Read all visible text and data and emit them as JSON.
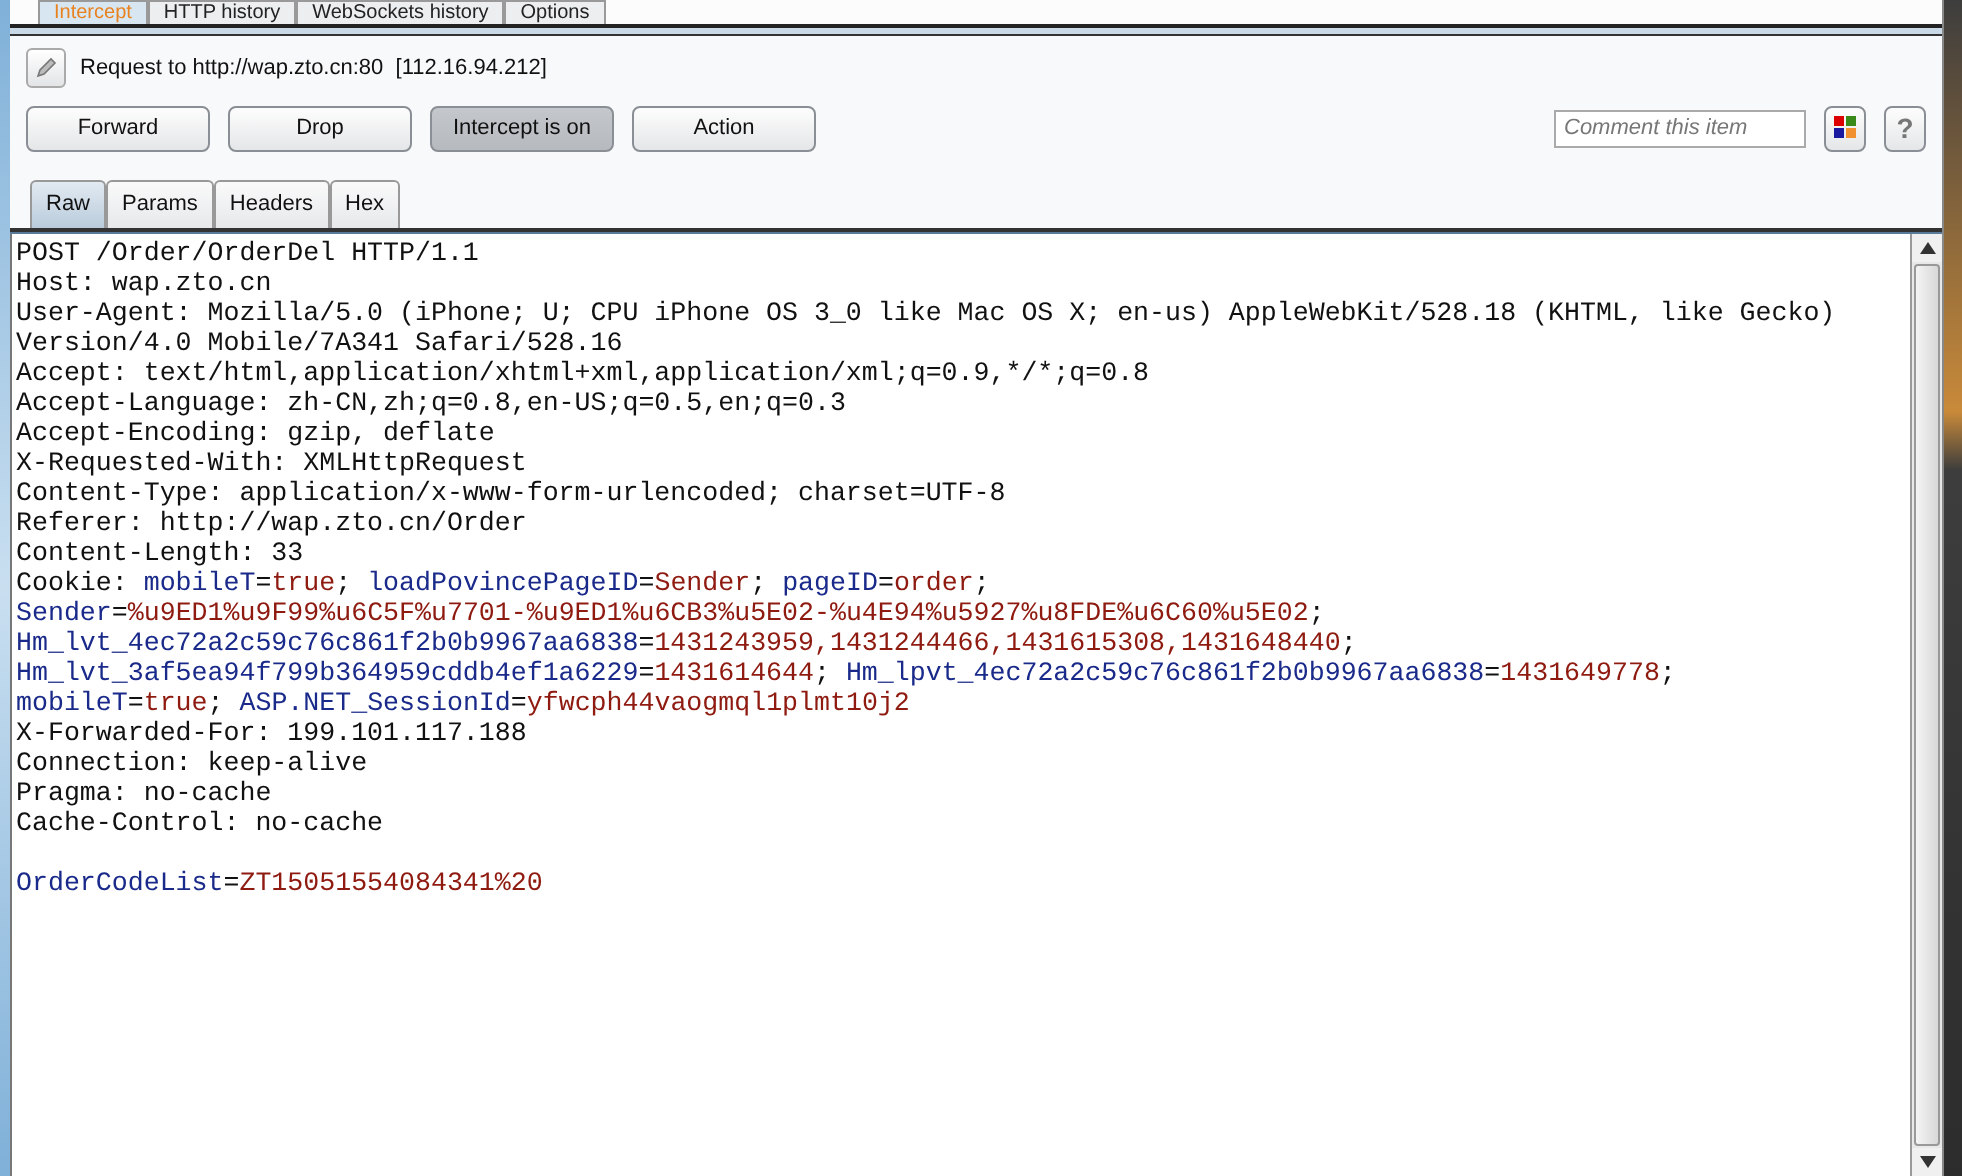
{
  "top_tabs": [
    {
      "label": "Intercept",
      "selected": true
    },
    {
      "label": "HTTP history",
      "selected": false
    },
    {
      "label": "WebSockets history",
      "selected": false
    },
    {
      "label": "Options",
      "selected": false
    }
  ],
  "request_info": "Request to http://wap.zto.cn:80  [112.16.94.212]",
  "buttons": [
    {
      "label": "Forward",
      "pressed": false
    },
    {
      "label": "Drop",
      "pressed": false
    },
    {
      "label": "Intercept is on",
      "pressed": true
    },
    {
      "label": "Action",
      "pressed": false
    }
  ],
  "comment": {
    "placeholder": "Comment this item"
  },
  "help_button": "?",
  "message_tabs": [
    {
      "label": "Raw",
      "selected": true
    },
    {
      "label": "Params",
      "selected": false
    },
    {
      "label": "Headers",
      "selected": false
    },
    {
      "label": "Hex",
      "selected": false
    }
  ],
  "lines": [
    [
      {
        "kind": "text",
        "text": "POST /Order/OrderDel HTTP/1.1"
      }
    ],
    [
      {
        "kind": "text",
        "text": "Host: wap.zto.cn"
      }
    ],
    [
      {
        "kind": "text",
        "text": "User-Agent: Mozilla/5.0 (iPhone; U; CPU iPhone OS 3_0 like Mac OS X; en-us) AppleWebKit/528.18 (KHTML, like Gecko)"
      }
    ],
    [
      {
        "kind": "text",
        "text": "Version/4.0 Mobile/7A341 Safari/528.16"
      }
    ],
    [
      {
        "kind": "text",
        "text": "Accept: text/html,application/xhtml+xml,application/xml;q=0.9,*/*;q=0.8"
      }
    ],
    [
      {
        "kind": "text",
        "text": "Accept-Language: zh-CN,zh;q=0.8,en-US;q=0.5,en;q=0.3"
      }
    ],
    [
      {
        "kind": "text",
        "text": "Accept-Encoding: gzip, deflate"
      }
    ],
    [
      {
        "kind": "text",
        "text": "X-Requested-With: XMLHttpRequest"
      }
    ],
    [
      {
        "kind": "text",
        "text": "Content-Type: application/x-www-form-urlencoded; charset=UTF-8"
      }
    ],
    [
      {
        "kind": "text",
        "text": "Referer: http://wap.zto.cn/Order"
      }
    ],
    [
      {
        "kind": "text",
        "text": "Content-Length: 33"
      }
    ],
    [
      {
        "kind": "text",
        "text": "Cookie: "
      },
      {
        "kind": "name",
        "text": "mobileT"
      },
      {
        "kind": "text",
        "text": "="
      },
      {
        "kind": "value",
        "text": "true"
      },
      {
        "kind": "text",
        "text": "; "
      },
      {
        "kind": "name",
        "text": "loadPovincePageID"
      },
      {
        "kind": "text",
        "text": "="
      },
      {
        "kind": "value",
        "text": "Sender"
      },
      {
        "kind": "text",
        "text": "; "
      },
      {
        "kind": "name",
        "text": "pageID"
      },
      {
        "kind": "text",
        "text": "="
      },
      {
        "kind": "value",
        "text": "order"
      },
      {
        "kind": "text",
        "text": ";"
      }
    ],
    [
      {
        "kind": "name",
        "text": "Sender"
      },
      {
        "kind": "text",
        "text": "="
      },
      {
        "kind": "value",
        "text": "%u9ED1%u9F99%u6C5F%u7701-%u9ED1%u6CB3%u5E02-%u4E94%u5927%u8FDE%u6C60%u5E02"
      },
      {
        "kind": "text",
        "text": ";"
      }
    ],
    [
      {
        "kind": "name",
        "text": "Hm_lvt_4ec72a2c59c76c861f2b0b9967aa6838"
      },
      {
        "kind": "text",
        "text": "="
      },
      {
        "kind": "value",
        "text": "1431243959,1431244466,1431615308,1431648440"
      },
      {
        "kind": "text",
        "text": ";"
      }
    ],
    [
      {
        "kind": "name",
        "text": "Hm_lvt_3af5ea94f799b364959cddb4ef1a6229"
      },
      {
        "kind": "text",
        "text": "="
      },
      {
        "kind": "value",
        "text": "1431614644"
      },
      {
        "kind": "text",
        "text": "; "
      },
      {
        "kind": "name",
        "text": "Hm_lpvt_4ec72a2c59c76c861f2b0b9967aa6838"
      },
      {
        "kind": "text",
        "text": "="
      },
      {
        "kind": "value",
        "text": "1431649778"
      },
      {
        "kind": "text",
        "text": ";"
      }
    ],
    [
      {
        "kind": "name",
        "text": "mobileT"
      },
      {
        "kind": "text",
        "text": "="
      },
      {
        "kind": "value",
        "text": "true"
      },
      {
        "kind": "text",
        "text": "; "
      },
      {
        "kind": "name",
        "text": "ASP.NET_SessionId"
      },
      {
        "kind": "text",
        "text": "="
      },
      {
        "kind": "value",
        "text": "yfwcph44vaogmql1plmt10j2"
      }
    ],
    [
      {
        "kind": "text",
        "text": "X-Forwarded-For: 199.101.117.188"
      }
    ],
    [
      {
        "kind": "text",
        "text": "Connection: keep-alive"
      }
    ],
    [
      {
        "kind": "text",
        "text": "Pragma: no-cache"
      }
    ],
    [
      {
        "kind": "text",
        "text": "Cache-Control: no-cache"
      }
    ],
    [
      {
        "kind": "blank"
      }
    ],
    [
      {
        "kind": "name",
        "text": "OrderCodeList"
      },
      {
        "kind": "text",
        "text": "="
      },
      {
        "kind": "value",
        "text": "ZT15051554084341%20"
      }
    ]
  ]
}
